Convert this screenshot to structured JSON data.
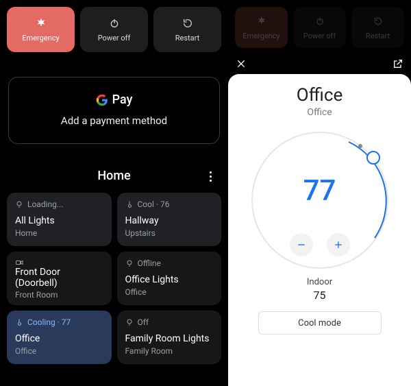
{
  "left": {
    "power": {
      "emergency": "Emergency",
      "poweroff": "Power off",
      "restart": "Restart"
    },
    "pay": {
      "brand_suffix": "Pay",
      "subtitle": "Add a payment method"
    },
    "home": {
      "title": "Home"
    },
    "tiles": [
      {
        "status": "Loading...",
        "title": "All Lights",
        "sub": "Home"
      },
      {
        "status": "Cool · 76",
        "title": "Hallway",
        "sub": "Upstairs"
      },
      {
        "status": "",
        "title": "Front Door (Doorbell)",
        "sub": "Front Room"
      },
      {
        "status": "Offline",
        "title": "Office Lights",
        "sub": "Office"
      },
      {
        "status": "Cooling · 77",
        "title": "Office",
        "sub": "Office"
      },
      {
        "status": "Off",
        "title": "Family Room Lights",
        "sub": "Family Room"
      }
    ]
  },
  "right": {
    "power": {
      "emergency": "Emergency",
      "poweroff": "Power off",
      "restart": "Restart"
    },
    "sheet": {
      "title": "Office",
      "subtitle": "Office",
      "setpoint": "77",
      "indoor_label": "Indoor",
      "indoor_value": "75",
      "mode_label": "Cool mode"
    }
  }
}
